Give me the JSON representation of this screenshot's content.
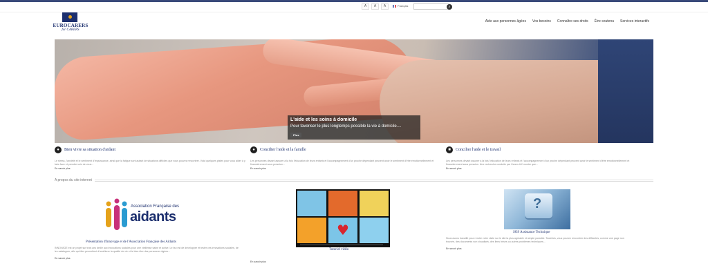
{
  "utility": {
    "font_small": "A",
    "font_medium": "A",
    "font_large": "A",
    "language": "Français",
    "search_placeholder": "",
    "search_icon": "search-icon"
  },
  "logo": {
    "title": "EUROCARERS",
    "subtitle": "for CARERS"
  },
  "nav": [
    "Aide aux personnes âgées",
    "Vos besoins",
    "Connaître ses droits",
    "Être soutenu",
    "Services interactifs"
  ],
  "hero": {
    "title": "L'aide et les soins à domicile",
    "text": "Pour favoriser le plus longtemps possible la vie à domicile....",
    "button": "Plus"
  },
  "columns": [
    {
      "icon": "person-icon",
      "title": "Bien vivre sa situation d'aidant",
      "text": "Le stress, l'anxiété et le sentiment d'impuissance, ainsi que la fatigue sont autant de situations difficiles que vous pouvez rencontrer. Voici quelques pistes pour vous aider à y faire face et prendre soin de vous...",
      "readmore": "En savoir plus"
    },
    {
      "icon": "person-icon",
      "title": "Concilier l'aide et la famille",
      "text": "Les personnes devant assurer à la fois l'éducation de leurs enfants et l'accompagnement d'un proche dépendant peuvent avoir le sentiment d'être émotionnellement et financièrement sous pression...",
      "readmore": "En savoir plus"
    },
    {
      "icon": "briefcase-icon",
      "title": "Concilier l'aide et le travail",
      "text": "Les personnes devant assurer à la fois l'éducation de leurs enfants et l'accompagnement d'un proche dépendant peuvent avoir le sentiment d'être émotionnellement et financièrement sous pression. Une recherche conduite par Carers UK montre que...",
      "readmore": "En savoir plus"
    }
  ],
  "section": {
    "title": "A propos du site internet"
  },
  "items": [
    {
      "logo_line1": "Association Française des",
      "logo_line2": "aidants",
      "title": "Présentation d'Innovage et de l'Association Française des Aidants",
      "text": "INNOVAGE est un projet sur trois ans dédié aux innovations sociales pour une vieillesse saine et active. Le but est de développer et tester ces innovations sociales, de les cataloguer, afin qu'elles permettent d'améliorer la qualité de vie et le bien être des personnes âgées...",
      "readmore": "En savoir plus"
    },
    {
      "title": "Tutoriel vidéo",
      "readmore": "En savoir plus"
    },
    {
      "title": "SOS Assistance Technique",
      "text": "Nous avons travaillé pour rendre votre visite sur le site la plus agréable et simple possible. Toutefois, vous pouvez rencontrer des difficultés, comme une page non trouvée, des documents non visualisés, des liens brisés ou autres problèmes techniques...",
      "readmore": "En savoir plus"
    }
  ],
  "colors": {
    "brand": "#1c2f6e",
    "accent": "#e5a21a"
  }
}
